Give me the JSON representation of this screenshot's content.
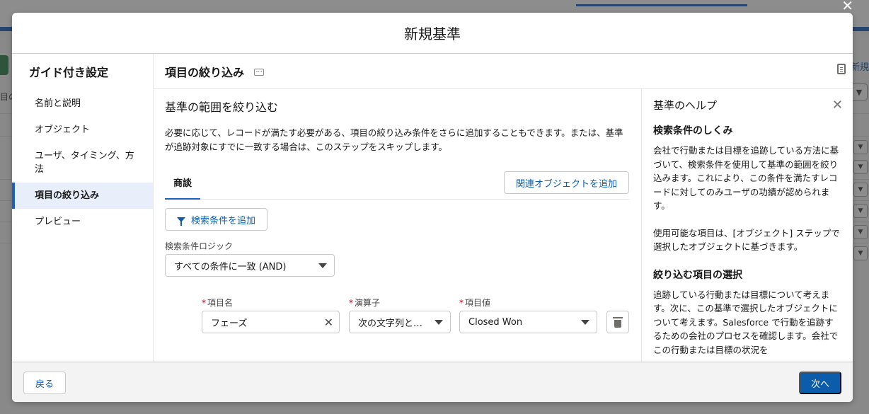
{
  "background": {
    "link_label": "新規",
    "left_fragment": "目の",
    "close_glyph": "✕"
  },
  "modal": {
    "title": "新規基準"
  },
  "nav": {
    "title": "ガイド付き設定",
    "items": [
      {
        "label": "名前と説明"
      },
      {
        "label": "オブジェクト"
      },
      {
        "label": "ユーザ、タイミング、方法"
      },
      {
        "label": "項目の絞り込み",
        "active": true
      },
      {
        "label": "プレビュー"
      }
    ]
  },
  "main": {
    "section_title": "項目の絞り込み",
    "heading": "基準の範囲を絞り込む",
    "description": "必要に応じて、レコードが満たす必要がある、項目の絞り込み条件をさらに追加することもできます。または、基準が追跡対象にすでに一致する場合は、このステップをスキップします。",
    "tab_label": "商談",
    "related_button": "関連オブジェクトを追加",
    "add_filter_button": "検索条件を追加",
    "logic_label": "検索条件ロジック",
    "logic_value": "すべての条件に一致 (AND)",
    "condition": {
      "field_label": "項目名",
      "field_value": "フェーズ",
      "operator_label": "演算子",
      "operator_value": "次の文字列と…",
      "value_label": "項目値",
      "value_value": "Closed Won"
    }
  },
  "help": {
    "title": "基準のヘルプ",
    "sections": [
      {
        "heading": "検索条件のしくみ",
        "paragraphs": [
          "会社で行動または目標を追跡している方法に基づいて、検索条件を使用して基準の範囲を絞り込みます。これにより、この条件を満たすレコードに対してのみユーザの功績が認められます。",
          "使用可能な項目は、[オブジェクト] ステップで選択したオブジェクトに基づきます。"
        ]
      },
      {
        "heading": "絞り込む項目の選択",
        "paragraphs": [
          "追跡している行動または目標について考えます。次に、この基準で選択したオブジェクトについて考えます。Salesforce で行動を追跡するための会社のプロセスを確認します。会社でこの行動または目標の状況を"
        ]
      }
    ]
  },
  "footer": {
    "back_label": "戻る",
    "next_label": "次へ"
  },
  "colors": {
    "brand": "#0b5cab",
    "active_nav_bg": "#e8effb",
    "required": "#ba0517"
  }
}
